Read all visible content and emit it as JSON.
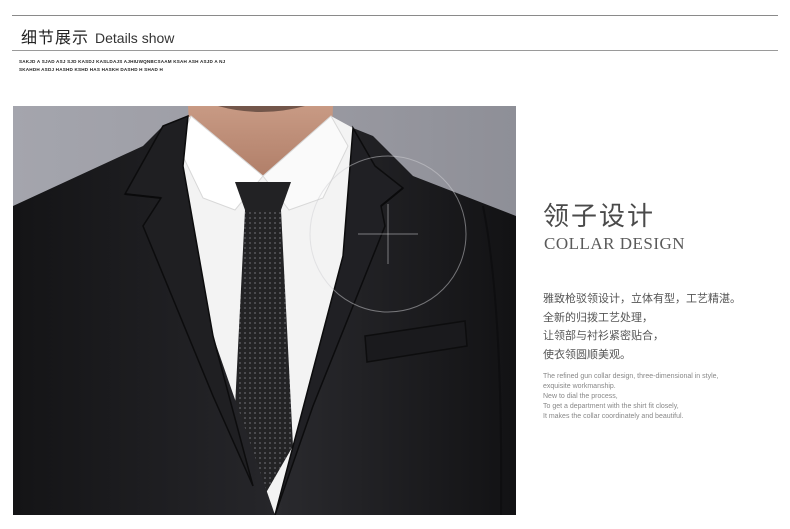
{
  "header": {
    "title_cn": "细节展示",
    "title_en": "Details show",
    "tiny_line_1": "SAKJD A SJAD ASJ  SJD KASDJ KASLDAJS AJHIUWQNBCSAAM  KSAH ASH ASJD A NJ",
    "tiny_line_2": "SKAHDH ASDJ HASHD KSHD HAS HASKH DASHD H  SHAD  H"
  },
  "photo": {
    "description_icon": "suit-collar-photo"
  },
  "feature": {
    "title_cn": "领子设计",
    "title_en": "COLLAR DESIGN",
    "lines_cn": [
      "雅致枪驳领设计，立体有型，工艺精湛。",
      "全新的归拨工艺处理，",
      "让领部与衬衫紧密贴合，",
      "使衣领圆顺美观。"
    ],
    "lines_en": [
      "The refined gun collar design, three-dimensional in style,",
      "exquisite workmanship.",
      "New to dial the process,",
      "To get a department with the shirt fit closely,",
      "It makes the collar coordinately and beautiful."
    ]
  },
  "colors": {
    "suit": "#1c1c1e",
    "shirt": "#f2f2f2",
    "background": "#9a9aa2",
    "tie": "#2a2a2c"
  }
}
